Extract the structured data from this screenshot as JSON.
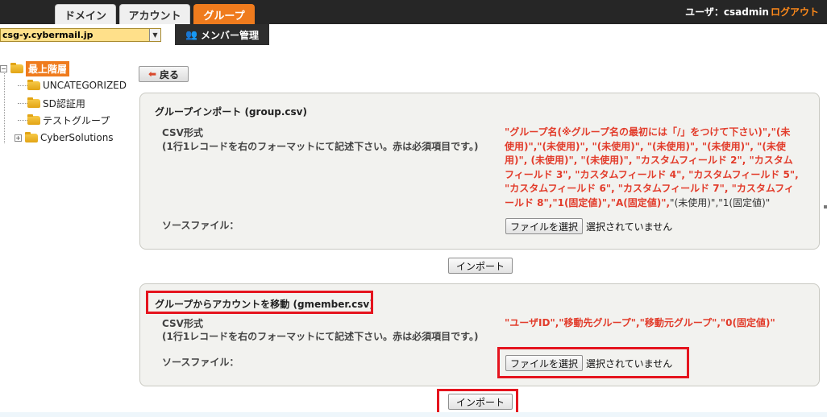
{
  "header": {
    "tabs": [
      {
        "label": "ドメイン",
        "active": false
      },
      {
        "label": "アカウント",
        "active": false
      },
      {
        "label": "グループ",
        "active": true
      }
    ],
    "user_label": "ユーザ：csadmin",
    "logout_label": "ログアウト"
  },
  "toolbar": {
    "domain_value": "csg-y.cybermail.jp",
    "member_mgmt_label": "メンバー管理"
  },
  "sidebar": {
    "root_label": "最上階層",
    "items": [
      {
        "label": "UNCATEGORIZED"
      },
      {
        "label": "SD認証用"
      },
      {
        "label": "テストグループ"
      },
      {
        "label": "CyberSolutions",
        "expandable": true
      }
    ]
  },
  "main": {
    "back_label": "戻る",
    "group_import": {
      "title": "グループインポート (group.csv)",
      "csv_label": "CSV形式",
      "csv_desc": "(1行1レコードを右のフォーマットにて記述下さい。赤は必須項目です。)",
      "format_red": "\"グループ名(※グループ名の最初には「/」をつけて下さい)\",\"(未使用)\",\"(未使用)\", \"(未使用)\", \"(未使用)\", \"(未使用)\", \"(未使用)\", (未使用)\", \"(未使用)\", \"カスタムフィールド 2\", \"カスタムフィールド 3\", \"カスタムフィールド 4\", \"カスタムフィールド 5\", \"カスタムフィールド 6\", \"カスタムフィールド 7\", \"カスタムフィールド 8\",\"1(固定値)\",\"A(固定値)\",",
      "format_black": "\"(未使用)\",\"1(固定値)\"",
      "source_label": "ソースファイル：",
      "file_button": "ファイルを選択",
      "file_status": "選択されていません",
      "import_label": "インポート"
    },
    "group_move": {
      "title": "グループからアカウントを移動 (gmember.csv)",
      "csv_label": "CSV形式",
      "csv_desc": "(1行1レコードを右のフォーマットにて記述下さい。赤は必須項目です。)",
      "format_red": "\"ユーザID\",\"移動先グループ\",\"移動元グループ\",\"0(固定値)\"",
      "source_label": "ソースファイル：",
      "file_button": "ファイルを選択",
      "file_status": "選択されていません",
      "import_label": "インポート"
    }
  },
  "colors": {
    "header_bg": "#262626",
    "accent_orange": "#ef7b1d",
    "required_red": "#e23c2b",
    "highlight_red": "#e5141e"
  }
}
